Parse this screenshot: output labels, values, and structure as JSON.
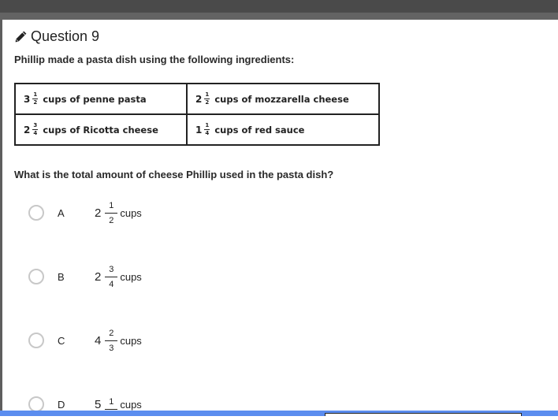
{
  "question": {
    "title": "Question 9",
    "icon": "pencil-icon",
    "prompt": "Phillip made a pasta dish using the following ingredients:",
    "ingredients": [
      [
        {
          "whole": "3",
          "numerator": "1",
          "denominator": "2",
          "text": "cups of penne pasta"
        },
        {
          "whole": "2",
          "numerator": "1",
          "denominator": "2",
          "text": "cups of mozzarella cheese"
        }
      ],
      [
        {
          "whole": "2",
          "numerator": "3",
          "denominator": "4",
          "text": "cups of Ricotta cheese"
        },
        {
          "whole": "1",
          "numerator": "1",
          "denominator": "4",
          "text": "cups of red sauce"
        }
      ]
    ],
    "ask": "What is the total amount of cheese Phillip used in the pasta dish?",
    "options": [
      {
        "letter": "A",
        "whole": "2",
        "numerator": "1",
        "denominator": "2",
        "unit": "cups",
        "selected": false
      },
      {
        "letter": "B",
        "whole": "2",
        "numerator": "3",
        "denominator": "4",
        "unit": "cups",
        "selected": false
      },
      {
        "letter": "C",
        "whole": "4",
        "numerator": "2",
        "denominator": "3",
        "unit": "cups",
        "selected": false
      },
      {
        "letter": "D",
        "whole": "5",
        "numerator": "1",
        "denominator": "",
        "unit": "cups",
        "selected": false
      }
    ]
  },
  "colors": {
    "accent_bar": "#5b8def",
    "radio_border": "#c8c8c8"
  }
}
